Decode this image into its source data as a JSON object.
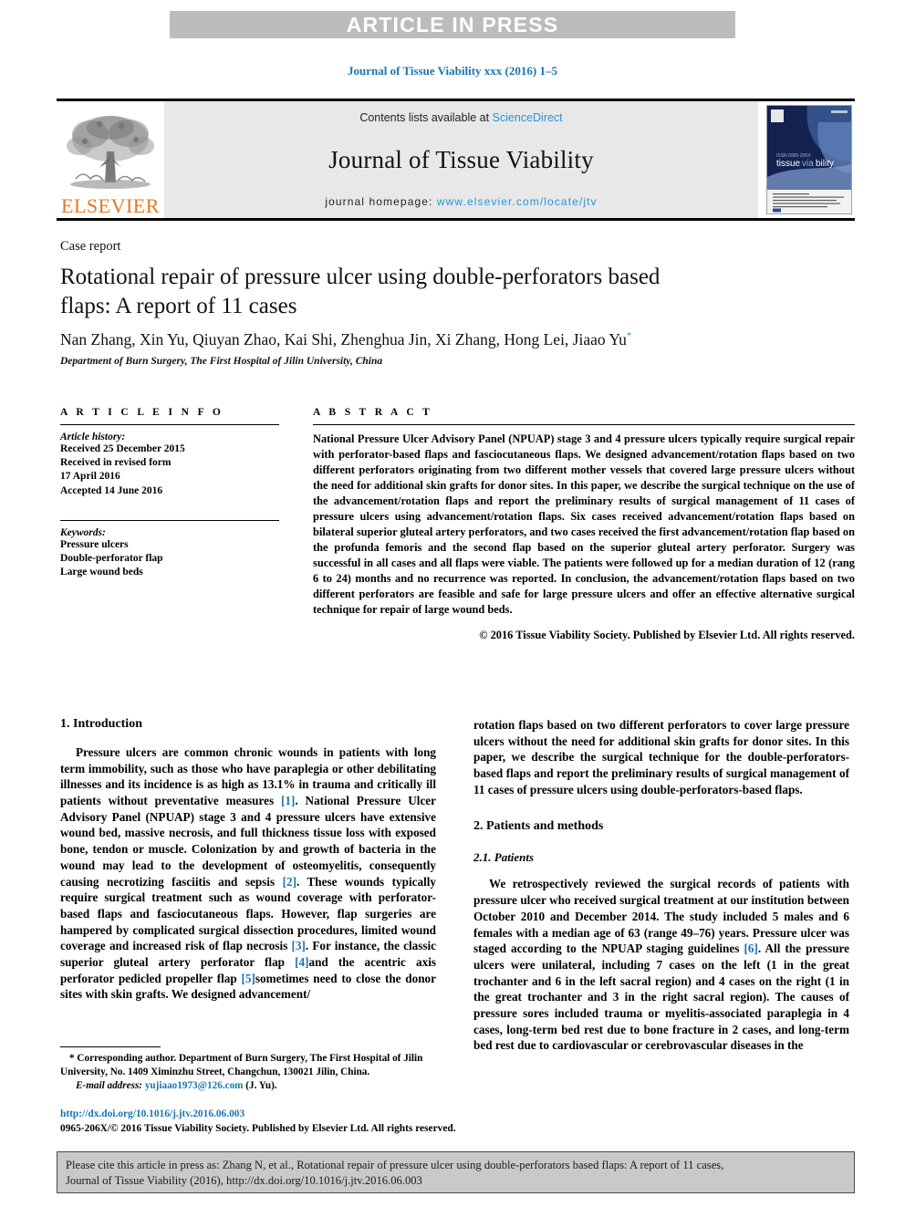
{
  "banner": {
    "text": "ARTICLE IN PRESS"
  },
  "running_head": "Journal of Tissue Viability xxx (2016) 1–5",
  "masthead": {
    "contents_prefix": "Contents lists available at ",
    "sciencedirect": "ScienceDirect",
    "journal_title": "Journal of Tissue Viability",
    "homepage_prefix": "journal homepage: ",
    "homepage_url": "www.elsevier.com/locate/jtv",
    "publisher": "ELSEVIER",
    "cover_title_a": "tissue",
    "cover_title_b": "viability"
  },
  "article": {
    "type": "Case report",
    "title": "Rotational repair of pressure ulcer using double-perforators based flaps: A report of 11 cases",
    "authors": "Nan Zhang, Xin Yu, Qiuyan Zhao, Kai Shi, Zhenghua Jin, Xi Zhang, Hong Lei, Jiaao Yu",
    "corresponding_mark": "*",
    "affiliation": "Department of Burn Surgery, The First Hospital of Jilin University, China"
  },
  "info": {
    "heading": "A R T I C L E   I N F O",
    "history_label": "Article history:",
    "history": [
      "Received 25 December 2015",
      "Received in revised form",
      "17 April 2016",
      "Accepted 14 June 2016"
    ],
    "keywords_label": "Keywords:",
    "keywords": [
      "Pressure ulcers",
      "Double-perforator flap",
      "Large wound beds"
    ]
  },
  "abstract": {
    "heading": "A B S T R A C T",
    "text": "National Pressure Ulcer Advisory Panel (NPUAP) stage 3 and 4 pressure ulcers typically require surgical repair with perforator-based flaps and fasciocutaneous flaps. We designed advancement/rotation flaps based on two different perforators originating from two different mother vessels that covered large pressure ulcers without the need for additional skin grafts for donor sites. In this paper, we describe the surgical technique on the use of the advancement/rotation flaps and report the preliminary results of surgical management of 11 cases of pressure ulcers using advancement/rotation flaps. Six cases received advancement/rotation flaps based on bilateral superior gluteal artery perforators, and two cases received the first advancement/rotation flap based on the profunda femoris and the second flap based on the superior gluteal artery perforator. Surgery was successful in all cases and all flaps were viable. The patients were followed up for a median duration of 12 (rang 6 to 24) months and no recurrence was reported. In conclusion, the advancement/rotation flaps based on two different perforators are feasible and safe for large pressure ulcers and offer an effective alternative surgical technique for repair of large wound beds.",
    "copyright": "© 2016 Tissue Viability Society. Published by Elsevier Ltd. All rights reserved."
  },
  "body": {
    "intro_heading": "1. Introduction",
    "intro_p1_a": "Pressure ulcers are common chronic wounds in patients with long term immobility, such as those who have paraplegia or other debilitating illnesses and its incidence is as high as 13.1% in trauma and critically ill patients without preventative measures ",
    "intro_ref1": "[1]",
    "intro_p1_b": ". National Pressure Ulcer Advisory Panel (NPUAP) stage 3 and 4 pressure ulcers have extensive wound bed, massive necrosis, and full thickness tissue loss with exposed bone, tendon or muscle. Colonization by and growth of bacteria in the wound may lead to the development of osteomyelitis, consequently causing necrotizing fasciitis and sepsis ",
    "intro_ref2": "[2]",
    "intro_p1_c": ". These wounds typically require surgical treatment such as wound coverage with perforator-based flaps and fasciocutaneous flaps. However, flap surgeries are hampered by complicated surgical dissection procedures, limited wound coverage and increased risk of flap necrosis ",
    "intro_ref3": "[3]",
    "intro_p1_d": ". For instance, the classic superior gluteal artery perforator flap ",
    "intro_ref4": "[4]",
    "intro_p1_e": "and the acentric axis perforator pedicled propeller flap ",
    "intro_ref5": "[5]",
    "intro_p1_f": "sometimes need to close the donor sites with skin grafts. We designed advancement/",
    "right_cont": "rotation flaps based on two different perforators to cover large pressure ulcers without the need for additional skin grafts for donor sites. In this paper, we describe the surgical technique for the double-perforators-based flaps and report the preliminary results of surgical management of 11 cases of pressure ulcers using double-perforators-based flaps.",
    "methods_heading": "2. Patients and methods",
    "patients_heading": "2.1. Patients",
    "patients_p1_a": "We retrospectively reviewed the surgical records of patients with pressure ulcer who received surgical treatment at our institution between October 2010 and December 2014. The study included 5 males and 6 females with a median age of 63 (range 49–76) years. Pressure ulcer was staged according to the NPUAP staging guidelines ",
    "patients_ref6": "[6]",
    "patients_p1_b": ". All the pressure ulcers were unilateral, including 7 cases on the left (1 in the great trochanter and 6 in the left sacral region) and 4 cases on the right (1 in the great trochanter and 3 in the right sacral region). The causes of pressure sores included trauma or myelitis-associated paraplegia in 4 cases, long-term bed rest due to bone fracture in 2 cases, and long-term bed rest due to cardiovascular or cerebrovascular diseases in the"
  },
  "footnote": {
    "corresponding": "* Corresponding author. Department of Burn Surgery, The First Hospital of Jilin University, No. 1409 Ximinzhu Street, Changchun, 130021 Jilin, China.",
    "email_label": "E-mail address:",
    "email": "yujiaao1973@126.com",
    "email_suffix": "(J. Yu)."
  },
  "doi": {
    "url": "http://dx.doi.org/10.1016/j.jtv.2016.06.003",
    "issn_line": "0965-206X/© 2016 Tissue Viability Society. Published by Elsevier Ltd. All rights reserved."
  },
  "cite_box": {
    "line1": "Please cite this article in press as: Zhang N, et al., Rotational repair of pressure ulcer using double-perforators based flaps: A report of 11 cases,",
    "line2": "Journal of Tissue Viability (2016), http://dx.doi.org/10.1016/j.jtv.2016.06.003"
  },
  "colors": {
    "link_blue": "#1a74b0",
    "sciencedirect_blue": "#2a94d6",
    "elsevier_orange": "#e87722",
    "banner_gray": "#bcbcbc",
    "masthead_gray": "#e8e8e8",
    "cite_gray": "#c9c9c9"
  }
}
